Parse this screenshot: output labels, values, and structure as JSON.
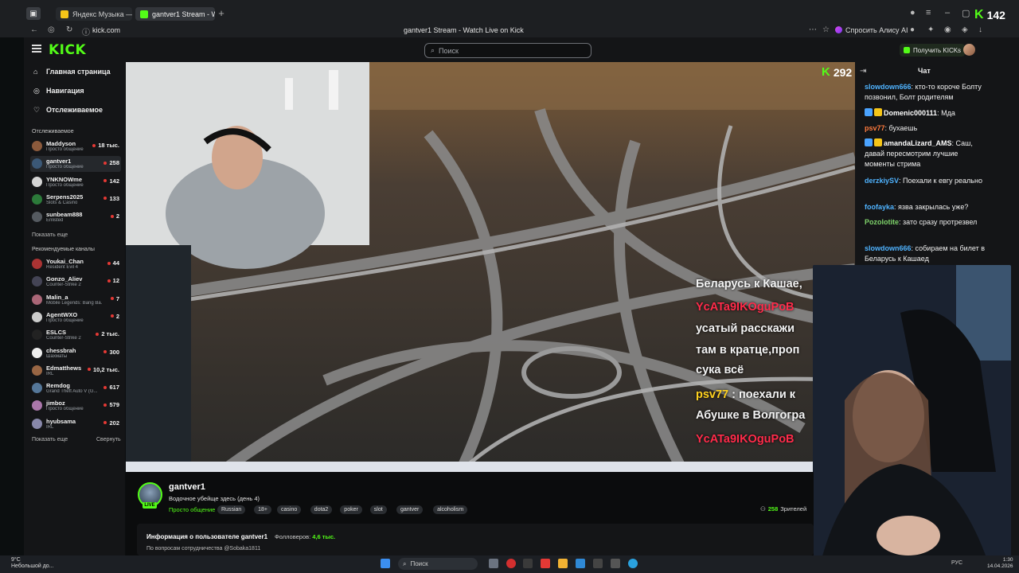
{
  "browser": {
    "tabs": [
      {
        "label": "Яндекс Музыка — собир",
        "icon": "yandex-music-icon",
        "color": "#f5c518"
      },
      {
        "label": "gantver1 Stream - W",
        "icon": "kick-favicon",
        "color": "#53fc18"
      }
    ],
    "new_tab": "+",
    "url": "kick.com",
    "page_title": "gantver1 Stream - Watch Live on Kick",
    "alice_label": "Спросить Алису AI",
    "top_right_count": "142"
  },
  "header": {
    "logo": "KICK",
    "search_placeholder": "Поиск",
    "get_kicks": "Получить KICKs"
  },
  "sidebar": {
    "nav": [
      {
        "label": "Главная страница",
        "icon": "home-icon"
      },
      {
        "label": "Навигация",
        "icon": "compass-icon"
      },
      {
        "label": "Отслеживаемое",
        "icon": "heart-icon"
      }
    ],
    "following_title": "Отслеживаемое",
    "following": [
      {
        "name": "Maddyson",
        "sub": "Просто общение",
        "viewers": "18 тыс.",
        "color": "#8b5a3c"
      },
      {
        "name": "gantver1",
        "sub": "Просто общение",
        "viewers": "258",
        "color": "#3b5876"
      },
      {
        "name": "YNKNOWme",
        "sub": "Просто общение",
        "viewers": "142",
        "color": "#d5d5d5"
      },
      {
        "name": "Serpens2025",
        "sub": "Slots & Casino",
        "viewers": "133",
        "color": "#2c7a3a"
      },
      {
        "name": "sunbeam888",
        "sub": "Enlisted",
        "viewers": "2",
        "color": "#555a60"
      }
    ],
    "show_more": "Показать еще",
    "recommended_title": "Рекомендуемые каналы",
    "recommended": [
      {
        "name": "Youkai_Chan",
        "sub": "Resident Evil 4",
        "viewers": "44",
        "color": "#a33"
      },
      {
        "name": "Gonzo_Aliev",
        "sub": "Counter-Strike 2",
        "viewers": "12",
        "color": "#445"
      },
      {
        "name": "Malin_a",
        "sub": "Mobile Legends: Bang Ba...",
        "viewers": "7",
        "color": "#a67"
      },
      {
        "name": "AgentWXO",
        "sub": "Просто общение",
        "viewers": "2",
        "color": "#ccc"
      },
      {
        "name": "ESLCS",
        "sub": "Counter-Strike 2",
        "viewers": "2 тыс.",
        "color": "#222"
      },
      {
        "name": "chessbrah",
        "sub": "Шахматы",
        "viewers": "300",
        "color": "#eee"
      },
      {
        "name": "Edmatthews",
        "sub": "IRL",
        "viewers": "10,2 тыс.",
        "color": "#964"
      },
      {
        "name": "Remdog",
        "sub": "Grand Theft Auto V (G...",
        "viewers": "617",
        "color": "#579"
      },
      {
        "name": "jimboz",
        "sub": "Просто общение",
        "viewers": "579",
        "color": "#a7a"
      },
      {
        "name": "hyubsama",
        "sub": "IRL",
        "viewers": "202",
        "color": "#88a"
      }
    ],
    "show_more_2": "Показать еще",
    "collapse": "Свернуть"
  },
  "video": {
    "live_count": "292",
    "overlay_lines": [
      {
        "text": "Беларусь к Кашае,",
        "red": false
      },
      {
        "text": "YcATa9IKOguPoB",
        "red": true
      },
      {
        "text": "усатый расскажи",
        "red": false
      },
      {
        "text": "там в кратце,проп",
        "red": false
      },
      {
        "text": "сука всё",
        "red": false
      },
      {
        "user": "psv77",
        "text": " : поехали к",
        "red": false
      },
      {
        "text": "Абушке в Волгогра",
        "red": false
      },
      {
        "text": "YcATa9IKOguPoB",
        "red": true
      }
    ]
  },
  "chat": {
    "title": "Чат",
    "messages": [
      {
        "user": "slowdown666",
        "color": "#4fb3ff",
        "text": "кто-то короче Болту позвонил, Болт родителям"
      },
      {
        "user": "Domenic000111",
        "color": "#ffffff",
        "text": "Мда",
        "badges": true
      },
      {
        "user": "psv77",
        "color": "#ff7a3d",
        "text": "бухаешь"
      },
      {
        "user": "amandaLizard_AMS",
        "color": "#ffffff",
        "text": "Саш, давай пересмотрим лучшие моменты стрима",
        "badges": true
      },
      {
        "user": "derzkiySV",
        "color": "#4fb3ff",
        "text": "Поехали к евгу реально"
      },
      {
        "user": "foofayka",
        "color": "#4fb3ff",
        "text": "язва закрылась уже?"
      },
      {
        "user": "Pozolotite",
        "color": "#7fd46b",
        "text": "зато сразу протрезвел"
      },
      {
        "user": "slowdown666",
        "color": "#4fb3ff",
        "text": "собираем на билет в Беларусь к Кашаед"
      }
    ]
  },
  "stream_info": {
    "name": "gantver1",
    "live": "LIVE",
    "title": "Водочное убейще здесь (день 4)",
    "category": "Просто общение",
    "tags": [
      "Russian",
      "18+",
      "casino",
      "dota2",
      "poker",
      "slot",
      "gantver",
      "alcoholism"
    ],
    "viewers_count": "258",
    "viewers_label": "Зрителей",
    "about_title": "Информация о пользователе gantver1",
    "followers_label": "Фолловеров:",
    "followers_count": "4,6 тыс.",
    "about_desc": "По вопросам сотрудничества @Sobaka1811"
  },
  "taskbar": {
    "weather_temp": "9°C",
    "weather_desc": "Небольшой до...",
    "search": "Поиск",
    "lang": "РУС",
    "time": "1:30",
    "date": "14.04.2026"
  }
}
